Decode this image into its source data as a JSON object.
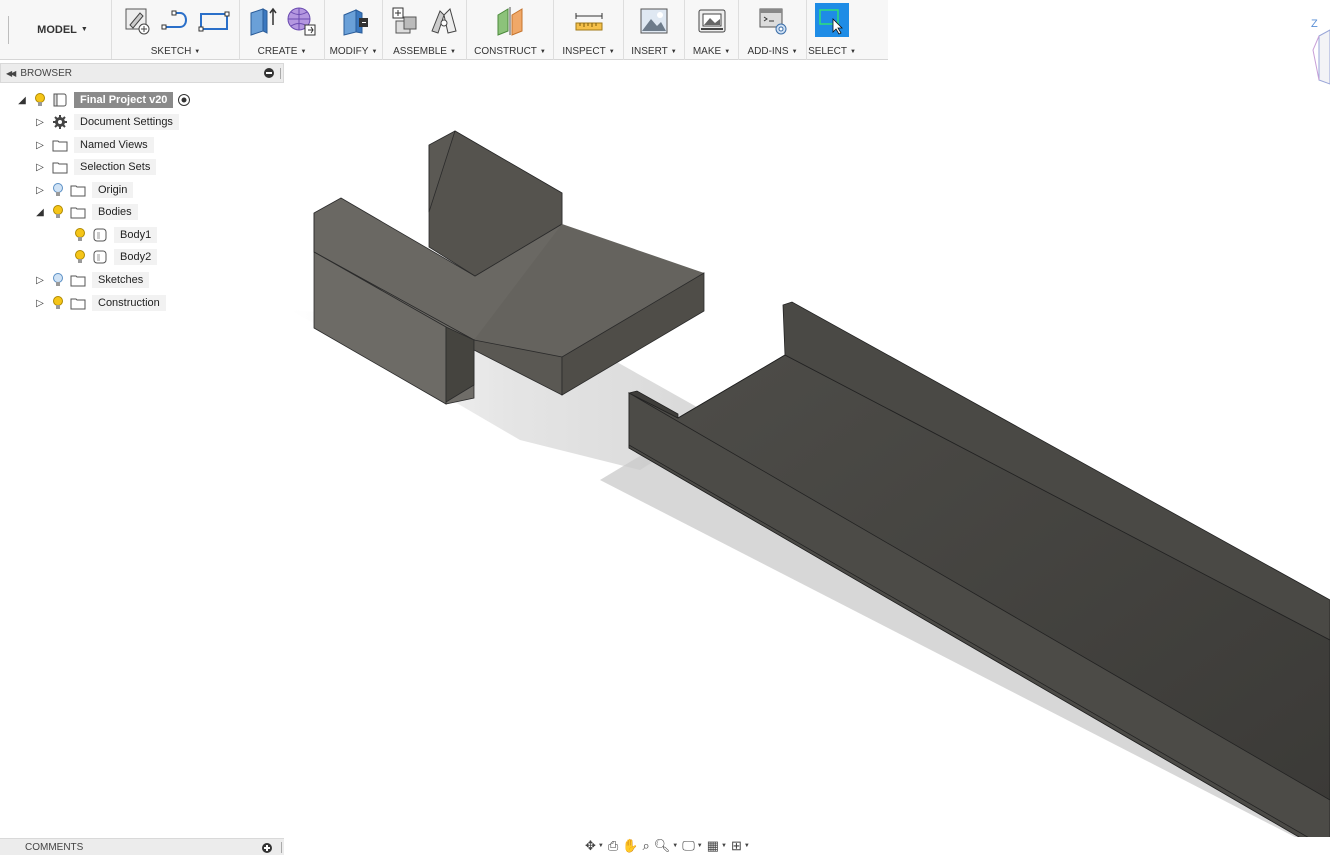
{
  "toolbar": {
    "workspace": "MODEL",
    "groups": {
      "sketch": "SKETCH",
      "create": "CREATE",
      "modify": "MODIFY",
      "assemble": "ASSEMBLE",
      "construct": "CONSTRUCT",
      "inspect": "INSPECT",
      "insert": "INSERT",
      "make": "MAKE",
      "addins": "ADD-INS",
      "select": "SELECT"
    },
    "icons": [
      "sketch-create-icon",
      "line-icon",
      "rectangle-icon",
      "extrude-icon",
      "form-icon",
      "press-pull-icon",
      "new-component-icon",
      "joint-icon",
      "plane-icon",
      "measure-icon",
      "insert-image-icon",
      "3d-print-icon",
      "scripts-icon",
      "select-icon"
    ],
    "accent": "#1e8ce6"
  },
  "browser": {
    "title": "BROWSER",
    "root": "Final Project v20",
    "nodes": {
      "document_settings": "Document Settings",
      "named_views": "Named Views",
      "selection_sets": "Selection Sets",
      "origin": "Origin",
      "bodies": "Bodies",
      "body1": "Body1",
      "body2": "Body2",
      "sketches": "Sketches",
      "construction": "Construction"
    }
  },
  "comments": {
    "title": "COMMENTS"
  },
  "viewcube": {
    "axis": "Z"
  },
  "colors": {
    "bulb_on": "#f5c518",
    "bulb_off": "#8fb7e0",
    "body": "#5a5852"
  }
}
